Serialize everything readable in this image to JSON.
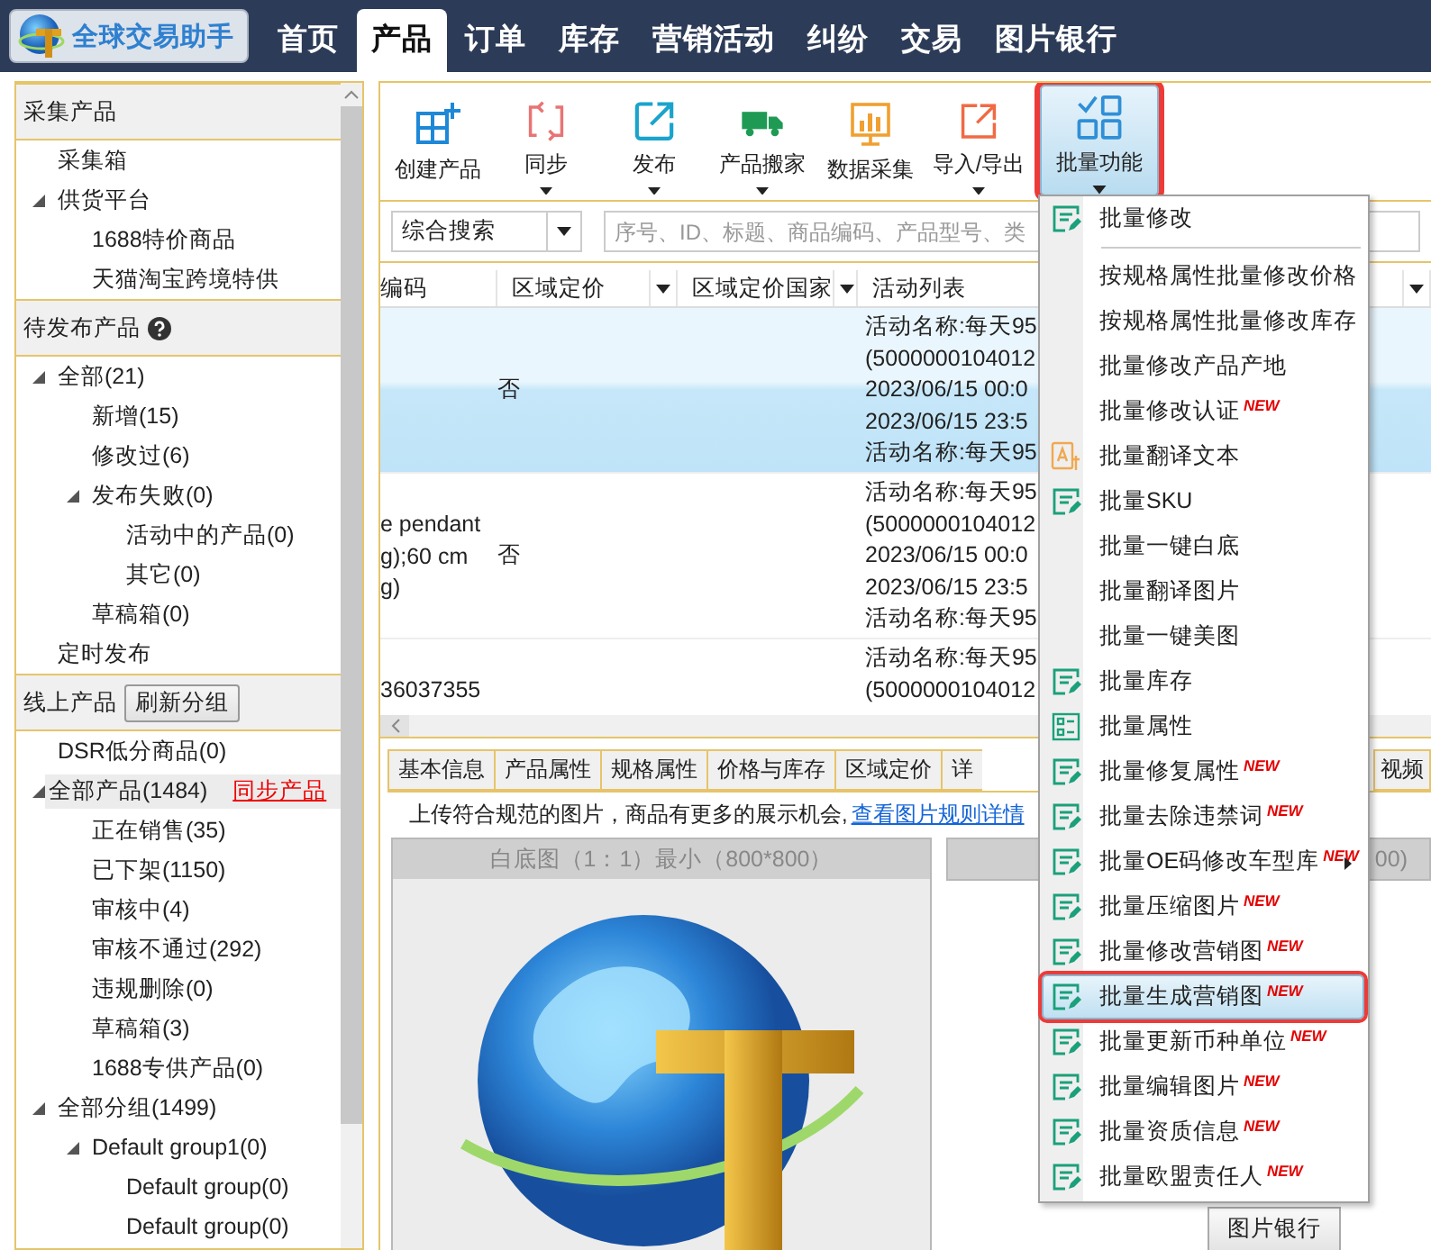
{
  "app": {
    "name": "全球交易助手"
  },
  "nav": [
    {
      "label": "首页",
      "selected": false
    },
    {
      "label": "产品",
      "selected": true
    },
    {
      "label": "订单",
      "selected": false
    },
    {
      "label": "库存",
      "selected": false
    },
    {
      "label": "营销活动",
      "selected": false
    },
    {
      "label": "纠纷",
      "selected": false
    },
    {
      "label": "交易",
      "selected": false
    },
    {
      "label": "图片银行",
      "selected": false
    }
  ],
  "sidebar": {
    "sections": [
      {
        "title": "采集产品",
        "items": [
          {
            "label": "采集箱",
            "selected": false
          },
          {
            "label": "供货平台",
            "selected": false,
            "expanded": true,
            "children": [
              {
                "label": "1688特价商品",
                "selected": false
              },
              {
                "label": "天猫淘宝跨境特供",
                "selected": false
              }
            ]
          }
        ]
      },
      {
        "title": "待发布产品",
        "help": true,
        "items": [
          {
            "label": "全部(21)",
            "selected": false,
            "expanded": true,
            "children": [
              {
                "label": "新增(15)",
                "selected": false
              },
              {
                "label": "修改过(6)",
                "selected": false
              },
              {
                "label": "发布失败(0)",
                "selected": false,
                "expanded": true,
                "children": [
                  {
                    "label": "活动中的产品(0)",
                    "selected": false
                  },
                  {
                    "label": "其它(0)",
                    "selected": false
                  }
                ]
              },
              {
                "label": "草稿箱(0)",
                "selected": false
              }
            ]
          },
          {
            "label": "定时发布",
            "selected": false
          }
        ]
      },
      {
        "title": "线上产品",
        "button": "刷新分组",
        "items": [
          {
            "label": "DSR低分商品(0)",
            "selected": false
          },
          {
            "label": "全部产品(1484)",
            "selected": true,
            "link": "同步产品",
            "expanded": true,
            "children": [
              {
                "label": "正在销售(35)",
                "selected": false
              },
              {
                "label": "已下架(1150)",
                "selected": false
              },
              {
                "label": "审核中(4)",
                "selected": false
              },
              {
                "label": "审核不通过(292)",
                "selected": false
              },
              {
                "label": "违规删除(0)",
                "selected": false
              },
              {
                "label": "草稿箱(3)",
                "selected": false
              },
              {
                "label": "1688专供产品(0)",
                "selected": false
              }
            ]
          },
          {
            "label": "全部分组(1499)",
            "selected": false,
            "expanded": true,
            "children": [
              {
                "label": "Default group1(0)",
                "selected": false,
                "expanded": true,
                "children": [
                  {
                    "label": "Default group(0)",
                    "selected": false
                  },
                  {
                    "label": "Default group(0)",
                    "selected": false
                  }
                ]
              }
            ]
          }
        ]
      }
    ]
  },
  "toolbar": [
    {
      "label": "创建产品",
      "kind": "grid-plus",
      "dropdown": false,
      "selected": false
    },
    {
      "label": "同步",
      "kind": "sync",
      "dropdown": true,
      "selected": false
    },
    {
      "label": "发布",
      "kind": "external-link",
      "dropdown": true,
      "selected": false
    },
    {
      "label": "产品搬家",
      "kind": "truck",
      "dropdown": true,
      "selected": false
    },
    {
      "label": "数据采集",
      "kind": "chart",
      "dropdown": false,
      "selected": false
    },
    {
      "label": "导入/导出",
      "kind": "upload",
      "dropdown": true,
      "selected": false
    },
    {
      "label": "批量功能",
      "kind": "grid-check",
      "dropdown": true,
      "selected": true
    }
  ],
  "search": {
    "scope": "综合搜索",
    "placeholder": "序号、ID、标题、商品编码、产品型号、类"
  },
  "table": {
    "columns": [
      {
        "label": "编码",
        "dropdown": false
      },
      {
        "label": "区域定价",
        "dropdown": true
      },
      {
        "label": "区域定价国家",
        "dropdown": true
      },
      {
        "label": "活动列表",
        "dropdown": true
      }
    ],
    "rows": [
      {
        "selected": true,
        "regional_pricing": "否",
        "activities": "活动名称:每天95\n(5000000104012\n2023/06/15 00:0\n2023/06/15 23:5\n活动名称:每天95"
      },
      {
        "selected": false,
        "code": "e pendant\ng);60 cm\ng)",
        "regional_pricing": "否",
        "activities": "活动名称:每天95\n(5000000104012\n2023/06/15 00:0\n2023/06/15 23:5\n活动名称:每天95"
      },
      {
        "selected": false,
        "code": "36037355",
        "activities": "活动名称:每天95\n(5000000104012"
      }
    ]
  },
  "detail": {
    "tabs": [
      "基本信息",
      "产品属性",
      "规格属性",
      "价格与库存",
      "区域定价",
      "详",
      "视频"
    ],
    "notice": "上传符合规范的图片，商品有更多的展示机会,",
    "notice_link": "查看图片规则详情",
    "images": [
      {
        "caption": "白底图（1：1）最小（800*800）"
      },
      {
        "caption": "00)"
      }
    ],
    "button": "图片银行"
  },
  "menu": {
    "items": [
      {
        "kind": "edit",
        "label": "批量修改",
        "selected": false
      },
      {
        "kind": "separator"
      },
      {
        "kind": "plain",
        "label": "按规格属性批量修改价格",
        "selected": false
      },
      {
        "kind": "plain",
        "label": "按规格属性批量修改库存",
        "selected": false
      },
      {
        "kind": "plain",
        "label": "批量修改产品产地",
        "selected": false
      },
      {
        "kind": "plain",
        "label": "批量修改认证",
        "badge": "NEW",
        "selected": false
      },
      {
        "kind": "translate",
        "label": "批量翻译文本",
        "selected": false
      },
      {
        "kind": "edit",
        "label": "批量SKU",
        "selected": false
      },
      {
        "kind": "plain",
        "label": "批量一键白底",
        "selected": false
      },
      {
        "kind": "plain",
        "label": "批量翻译图片",
        "selected": false
      },
      {
        "kind": "plain",
        "label": "批量一键美图",
        "selected": false
      },
      {
        "kind": "edit",
        "label": "批量库存",
        "selected": false
      },
      {
        "kind": "attributes",
        "label": "批量属性",
        "selected": false
      },
      {
        "kind": "edit",
        "label": "批量修复属性",
        "badge": "NEW",
        "selected": false
      },
      {
        "kind": "edit",
        "label": "批量去除违禁词",
        "badge": "NEW",
        "selected": false
      },
      {
        "kind": "edit",
        "label": "批量OE码修改车型库",
        "badge": "NEW",
        "submenu": true,
        "selected": false
      },
      {
        "kind": "edit",
        "label": "批量压缩图片",
        "badge": "NEW",
        "selected": false
      },
      {
        "kind": "edit",
        "label": "批量修改营销图",
        "badge": "NEW",
        "selected": false
      },
      {
        "kind": "edit",
        "label": "批量生成营销图",
        "badge": "NEW",
        "selected": true
      },
      {
        "kind": "edit",
        "label": "批量更新币种单位",
        "badge": "NEW",
        "selected": false
      },
      {
        "kind": "edit",
        "label": "批量编辑图片",
        "badge": "NEW",
        "selected": false
      },
      {
        "kind": "edit",
        "label": "批量资质信息",
        "badge": "NEW",
        "selected": false
      },
      {
        "kind": "edit",
        "label": "批量欧盟责任人",
        "badge": "NEW",
        "selected": false
      }
    ]
  }
}
